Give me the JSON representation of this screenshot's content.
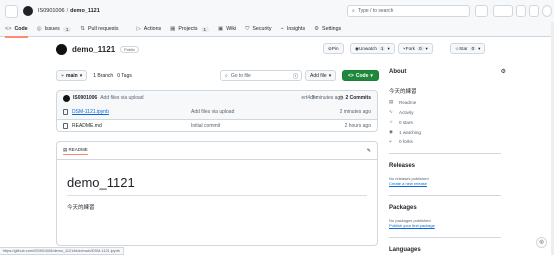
{
  "topbar": {
    "owner": "IS0901006",
    "sep": "/",
    "repo": "demo_1121",
    "search_placeholder": "Type / to search"
  },
  "tabs": [
    {
      "label": "Code",
      "icon": "<>"
    },
    {
      "label": "Issues",
      "count": "1",
      "icon": "◎"
    },
    {
      "label": "Pull requests",
      "count": "",
      "icon": "⇅"
    },
    {
      "label": "Actions",
      "icon": "▷"
    },
    {
      "label": "Projects",
      "count": "1",
      "icon": "▦"
    },
    {
      "label": "Wiki",
      "icon": "▣"
    },
    {
      "label": "Security",
      "icon": "⛉"
    },
    {
      "label": "Insights",
      "icon": "⌁"
    },
    {
      "label": "Settings",
      "icon": "⚙"
    }
  ],
  "repo": {
    "name": "demo_1121",
    "visibility": "Public"
  },
  "actions": {
    "pin": "Pin",
    "unwatch": "Unwatch",
    "unwatch_count": "1",
    "fork": "Fork",
    "fork_count": "0",
    "star": "Star",
    "star_count": "0"
  },
  "controls": {
    "branch": "main",
    "branches": "1 Branch",
    "tags": "0 Tags",
    "go_to_file": "Go to file",
    "go_kbd": "t",
    "add_file": "Add file",
    "code": "Code"
  },
  "commit": {
    "author": "IS0901006",
    "message": "Add files via upload",
    "hash": "ert4dfe",
    "time": "3 minutes ago",
    "commits": "2 Commits"
  },
  "files": [
    {
      "name": "DSM-1121.ipynb",
      "message": "Add files via upload",
      "time": "2 minutes ago",
      "link": true
    },
    {
      "name": "README.md",
      "message": "Initial commit",
      "time": "2 hours ago",
      "link": false
    }
  ],
  "readme": {
    "tab": "README",
    "title": "demo_1121",
    "text": "今天的練習"
  },
  "about": {
    "title": "About",
    "desc": "今天的練習",
    "items": [
      {
        "icon": "▤",
        "label": "Readme"
      },
      {
        "icon": "∿",
        "label": "Activity"
      },
      {
        "icon": "☆",
        "label": "0 stars"
      },
      {
        "icon": "◉",
        "label": "1 watching"
      },
      {
        "icon": "⑂",
        "label": "0 forks"
      }
    ]
  },
  "releases": {
    "title": "Releases",
    "none": "No releases published",
    "link": "Create a new release"
  },
  "packages": {
    "title": "Packages",
    "none": "No packages published",
    "link": "Publish your first package"
  },
  "languages": {
    "title": "Languages"
  },
  "statusbar": "https://github.com/IS0901006/demo_1121/blob/main/DSM-1121.ipynb"
}
